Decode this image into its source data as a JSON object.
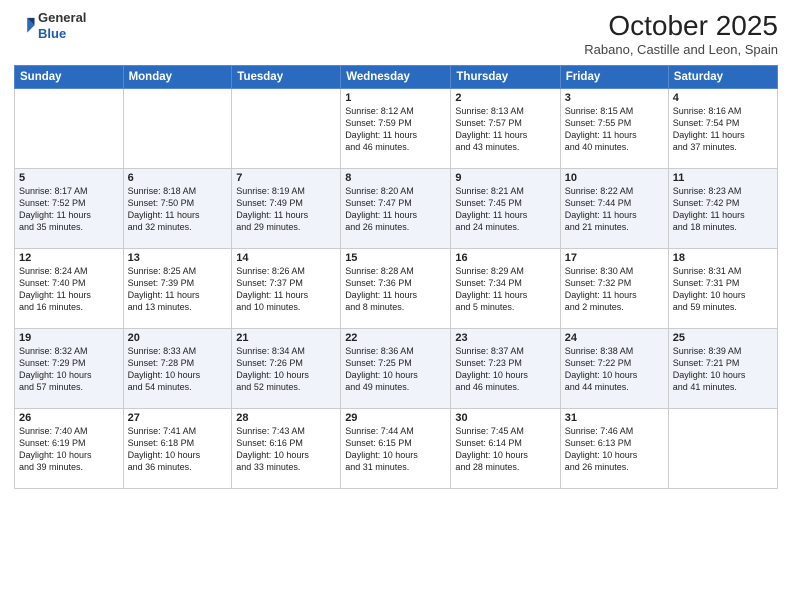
{
  "header": {
    "logo_line1": "General",
    "logo_line2": "Blue",
    "month": "October 2025",
    "location": "Rabano, Castille and Leon, Spain"
  },
  "weekdays": [
    "Sunday",
    "Monday",
    "Tuesday",
    "Wednesday",
    "Thursday",
    "Friday",
    "Saturday"
  ],
  "weeks": [
    [
      {
        "day": "",
        "info": ""
      },
      {
        "day": "",
        "info": ""
      },
      {
        "day": "",
        "info": ""
      },
      {
        "day": "1",
        "info": "Sunrise: 8:12 AM\nSunset: 7:59 PM\nDaylight: 11 hours\nand 46 minutes."
      },
      {
        "day": "2",
        "info": "Sunrise: 8:13 AM\nSunset: 7:57 PM\nDaylight: 11 hours\nand 43 minutes."
      },
      {
        "day": "3",
        "info": "Sunrise: 8:15 AM\nSunset: 7:55 PM\nDaylight: 11 hours\nand 40 minutes."
      },
      {
        "day": "4",
        "info": "Sunrise: 8:16 AM\nSunset: 7:54 PM\nDaylight: 11 hours\nand 37 minutes."
      }
    ],
    [
      {
        "day": "5",
        "info": "Sunrise: 8:17 AM\nSunset: 7:52 PM\nDaylight: 11 hours\nand 35 minutes."
      },
      {
        "day": "6",
        "info": "Sunrise: 8:18 AM\nSunset: 7:50 PM\nDaylight: 11 hours\nand 32 minutes."
      },
      {
        "day": "7",
        "info": "Sunrise: 8:19 AM\nSunset: 7:49 PM\nDaylight: 11 hours\nand 29 minutes."
      },
      {
        "day": "8",
        "info": "Sunrise: 8:20 AM\nSunset: 7:47 PM\nDaylight: 11 hours\nand 26 minutes."
      },
      {
        "day": "9",
        "info": "Sunrise: 8:21 AM\nSunset: 7:45 PM\nDaylight: 11 hours\nand 24 minutes."
      },
      {
        "day": "10",
        "info": "Sunrise: 8:22 AM\nSunset: 7:44 PM\nDaylight: 11 hours\nand 21 minutes."
      },
      {
        "day": "11",
        "info": "Sunrise: 8:23 AM\nSunset: 7:42 PM\nDaylight: 11 hours\nand 18 minutes."
      }
    ],
    [
      {
        "day": "12",
        "info": "Sunrise: 8:24 AM\nSunset: 7:40 PM\nDaylight: 11 hours\nand 16 minutes."
      },
      {
        "day": "13",
        "info": "Sunrise: 8:25 AM\nSunset: 7:39 PM\nDaylight: 11 hours\nand 13 minutes."
      },
      {
        "day": "14",
        "info": "Sunrise: 8:26 AM\nSunset: 7:37 PM\nDaylight: 11 hours\nand 10 minutes."
      },
      {
        "day": "15",
        "info": "Sunrise: 8:28 AM\nSunset: 7:36 PM\nDaylight: 11 hours\nand 8 minutes."
      },
      {
        "day": "16",
        "info": "Sunrise: 8:29 AM\nSunset: 7:34 PM\nDaylight: 11 hours\nand 5 minutes."
      },
      {
        "day": "17",
        "info": "Sunrise: 8:30 AM\nSunset: 7:32 PM\nDaylight: 11 hours\nand 2 minutes."
      },
      {
        "day": "18",
        "info": "Sunrise: 8:31 AM\nSunset: 7:31 PM\nDaylight: 10 hours\nand 59 minutes."
      }
    ],
    [
      {
        "day": "19",
        "info": "Sunrise: 8:32 AM\nSunset: 7:29 PM\nDaylight: 10 hours\nand 57 minutes."
      },
      {
        "day": "20",
        "info": "Sunrise: 8:33 AM\nSunset: 7:28 PM\nDaylight: 10 hours\nand 54 minutes."
      },
      {
        "day": "21",
        "info": "Sunrise: 8:34 AM\nSunset: 7:26 PM\nDaylight: 10 hours\nand 52 minutes."
      },
      {
        "day": "22",
        "info": "Sunrise: 8:36 AM\nSunset: 7:25 PM\nDaylight: 10 hours\nand 49 minutes."
      },
      {
        "day": "23",
        "info": "Sunrise: 8:37 AM\nSunset: 7:23 PM\nDaylight: 10 hours\nand 46 minutes."
      },
      {
        "day": "24",
        "info": "Sunrise: 8:38 AM\nSunset: 7:22 PM\nDaylight: 10 hours\nand 44 minutes."
      },
      {
        "day": "25",
        "info": "Sunrise: 8:39 AM\nSunset: 7:21 PM\nDaylight: 10 hours\nand 41 minutes."
      }
    ],
    [
      {
        "day": "26",
        "info": "Sunrise: 7:40 AM\nSunset: 6:19 PM\nDaylight: 10 hours\nand 39 minutes."
      },
      {
        "day": "27",
        "info": "Sunrise: 7:41 AM\nSunset: 6:18 PM\nDaylight: 10 hours\nand 36 minutes."
      },
      {
        "day": "28",
        "info": "Sunrise: 7:43 AM\nSunset: 6:16 PM\nDaylight: 10 hours\nand 33 minutes."
      },
      {
        "day": "29",
        "info": "Sunrise: 7:44 AM\nSunset: 6:15 PM\nDaylight: 10 hours\nand 31 minutes."
      },
      {
        "day": "30",
        "info": "Sunrise: 7:45 AM\nSunset: 6:14 PM\nDaylight: 10 hours\nand 28 minutes."
      },
      {
        "day": "31",
        "info": "Sunrise: 7:46 AM\nSunset: 6:13 PM\nDaylight: 10 hours\nand 26 minutes."
      },
      {
        "day": "",
        "info": ""
      }
    ]
  ]
}
